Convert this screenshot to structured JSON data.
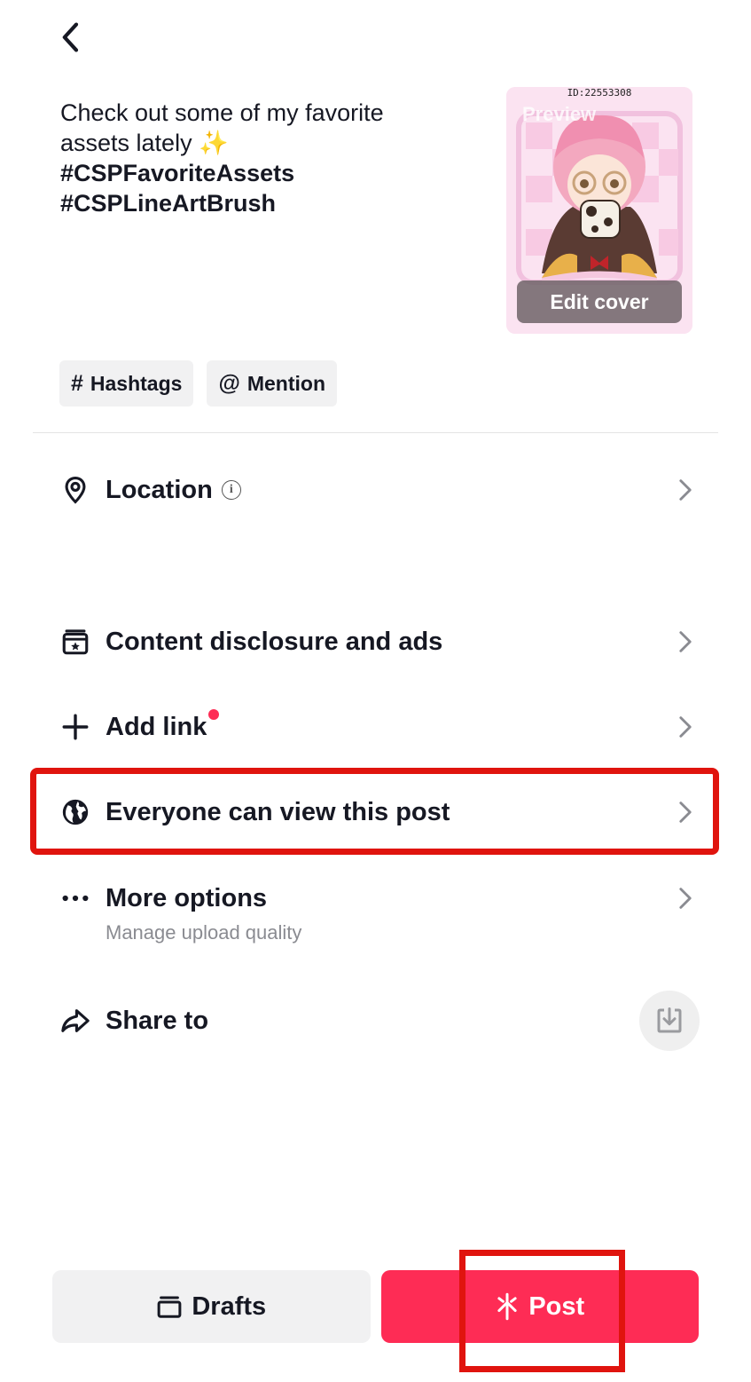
{
  "caption": {
    "line1": "Check out some of my favorite",
    "line2": "assets lately",
    "sparkle": "✨",
    "hashtag1": "#CSPFavoriteAssets",
    "hashtag2": "#CSPLineArtBrush"
  },
  "cover": {
    "id_label": "ID:22553308",
    "preview_label": "Preview",
    "edit_label": "Edit cover"
  },
  "chips": {
    "hashtags": {
      "symbol": "#",
      "label": "Hashtags"
    },
    "mention": {
      "symbol": "@",
      "label": "Mention"
    }
  },
  "rows": {
    "location": {
      "label": "Location",
      "icon": "location-pin-icon"
    },
    "disclosure": {
      "label": "Content disclosure and ads",
      "icon": "disclosure-icon"
    },
    "add_link": {
      "label": "Add link",
      "icon": "plus-icon"
    },
    "visibility": {
      "label": "Everyone can view this post",
      "icon": "globe-icon"
    },
    "more_options": {
      "label": "More options",
      "sublabel": "Manage upload quality",
      "icon": "more-dots-icon"
    },
    "share_to": {
      "label": "Share to",
      "icon": "share-arrow-icon"
    }
  },
  "buttons": {
    "drafts": "Drafts",
    "post": "Post"
  },
  "colors": {
    "accent": "#fe2c55",
    "highlight": "#e0140e",
    "chip_bg": "#f1f1f2"
  }
}
